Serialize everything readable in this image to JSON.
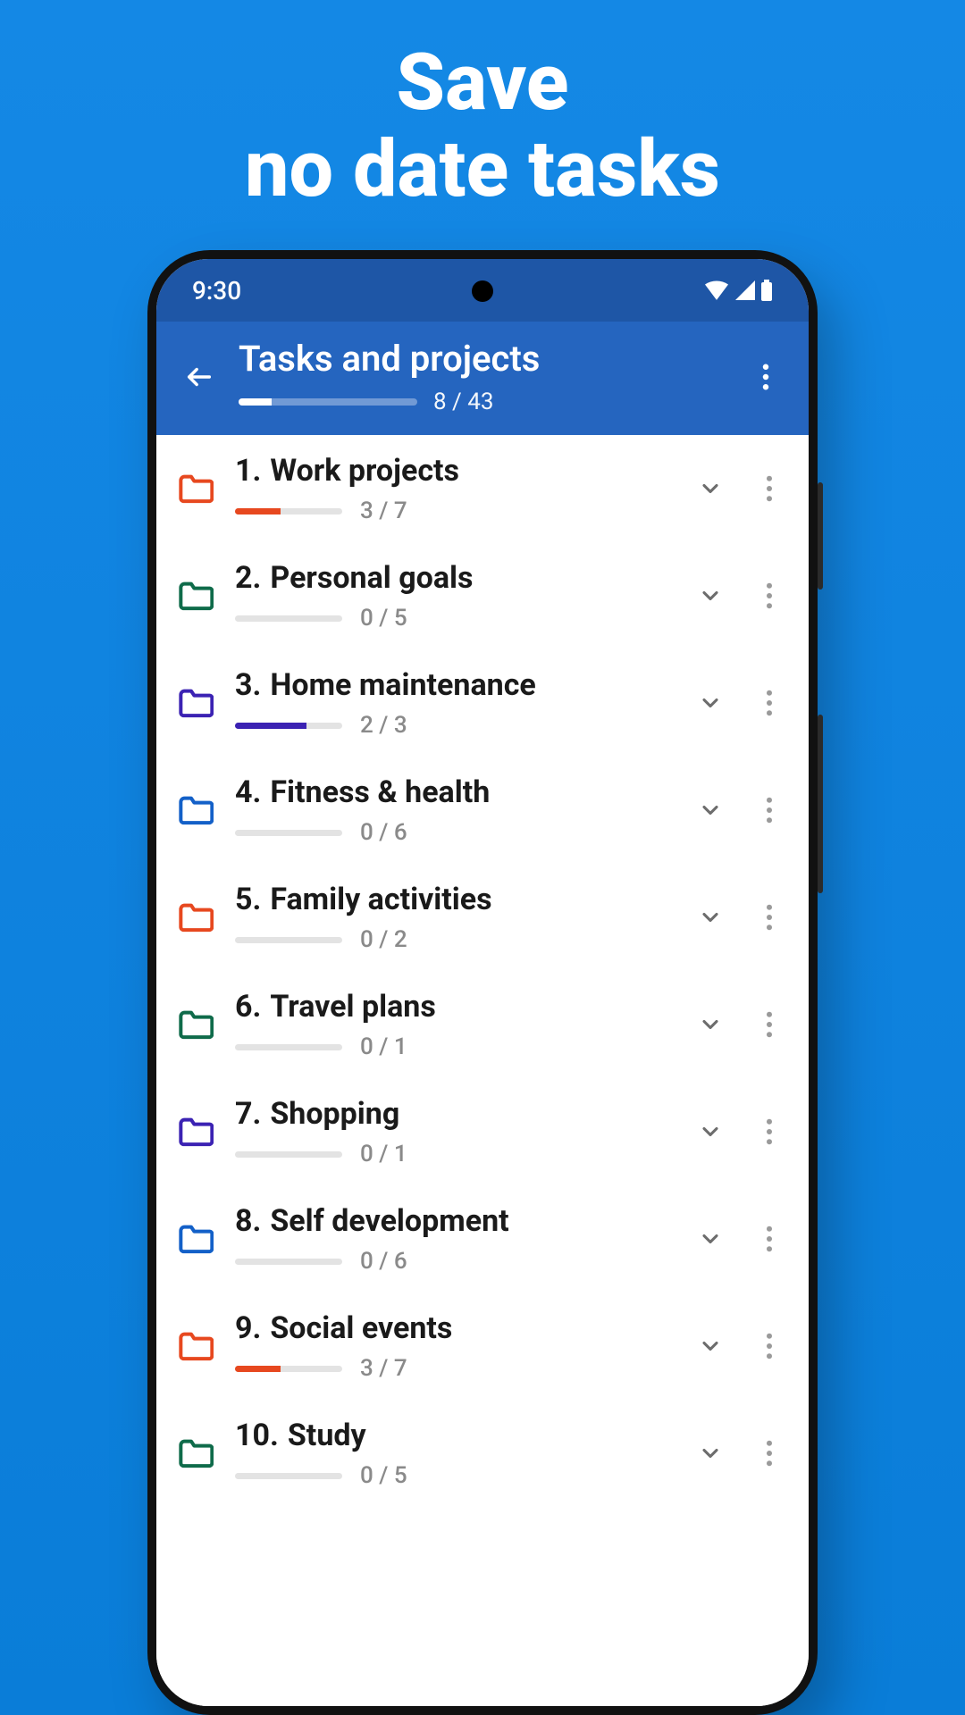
{
  "hero": {
    "line1": "Save",
    "line2": "no date tasks"
  },
  "status": {
    "time": "9:30"
  },
  "appbar": {
    "title": "Tasks and projects",
    "done": 8,
    "total": 43,
    "count_text": "8 / 43"
  },
  "folders": [
    {
      "num": "1.",
      "name": "Work projects",
      "done": 3,
      "total": 7,
      "count": "3 / 7",
      "color": "#e7481f"
    },
    {
      "num": "2.",
      "name": "Personal goals",
      "done": 0,
      "total": 5,
      "count": "0 / 5",
      "color": "#0f6b4a"
    },
    {
      "num": "3.",
      "name": "Home maintenance",
      "done": 2,
      "total": 3,
      "count": "2 / 3",
      "color": "#3b22b3"
    },
    {
      "num": "4.",
      "name": "Fitness & health",
      "done": 0,
      "total": 6,
      "count": "0 / 6",
      "color": "#1360c8"
    },
    {
      "num": "5.",
      "name": "Family activities",
      "done": 0,
      "total": 2,
      "count": "0 / 2",
      "color": "#e7481f"
    },
    {
      "num": "6.",
      "name": "Travel plans",
      "done": 0,
      "total": 1,
      "count": "0 / 1",
      "color": "#0f6b4a"
    },
    {
      "num": "7.",
      "name": "Shopping",
      "done": 0,
      "total": 1,
      "count": "0 / 1",
      "color": "#3b22b3"
    },
    {
      "num": "8.",
      "name": "Self development",
      "done": 0,
      "total": 6,
      "count": "0 / 6",
      "color": "#1360c8"
    },
    {
      "num": "9.",
      "name": "Social events",
      "done": 3,
      "total": 7,
      "count": "3 / 7",
      "color": "#e7481f"
    },
    {
      "num": "10.",
      "name": "Study",
      "done": 0,
      "total": 5,
      "count": "0 / 5",
      "color": "#0f6b4a"
    }
  ]
}
